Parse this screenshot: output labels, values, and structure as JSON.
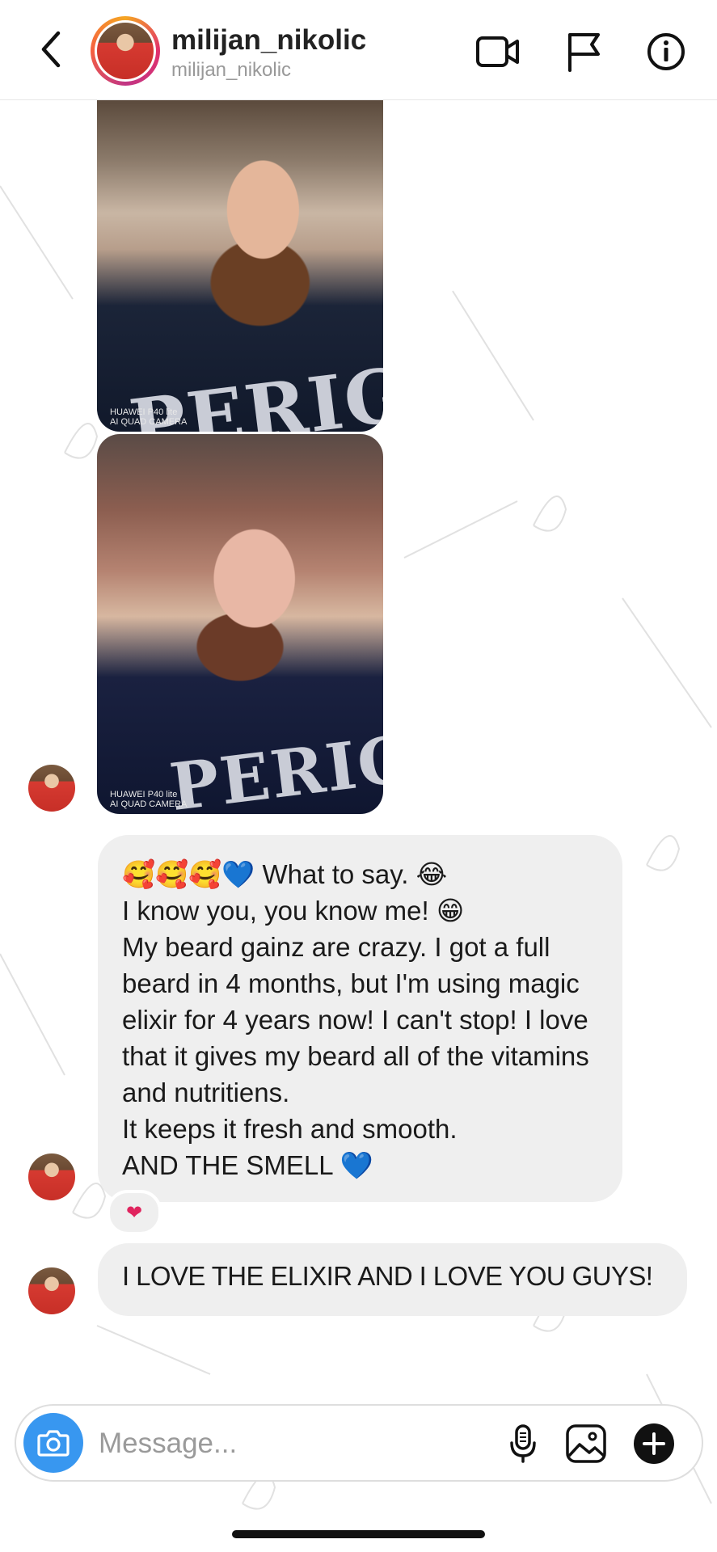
{
  "header": {
    "username": "milijan_nikolic",
    "handle": "milijan_nikolic",
    "icons": [
      "back-chevron-icon",
      "video-call-icon",
      "flag-icon",
      "info-icon"
    ]
  },
  "photos": [
    {
      "shirt_text": "PERIG",
      "camera_label_line1": "HUAWEI P40 lite",
      "camera_label_line2": "AI QUAD CAMERA"
    },
    {
      "shirt_text": "PERIG",
      "camera_label_line1": "HUAWEI P40 lite",
      "camera_label_line2": "AI QUAD CAMERA"
    }
  ],
  "messages": [
    {
      "text": "🥰🥰🥰💙 What to say. 😂\nI know you, you know me! 😁\nMy beard gainz are crazy. I got a full beard in 4 months, but I'm using magic elixir for 4 years now! I can't stop! I love that it gives my beard all of the vitamins and nutritiens.\nIt keeps it fresh and smooth.\nAND THE SMELL 💙",
      "reaction": "❤"
    },
    {
      "text": "I LOVE THE ELIXIR AND I LOVE YOU GUYS!"
    }
  ],
  "composer": {
    "placeholder": "Message...",
    "accent_color": "#3897f0",
    "icons": [
      "camera-icon",
      "microphone-icon",
      "gallery-icon",
      "plus-icon"
    ]
  }
}
